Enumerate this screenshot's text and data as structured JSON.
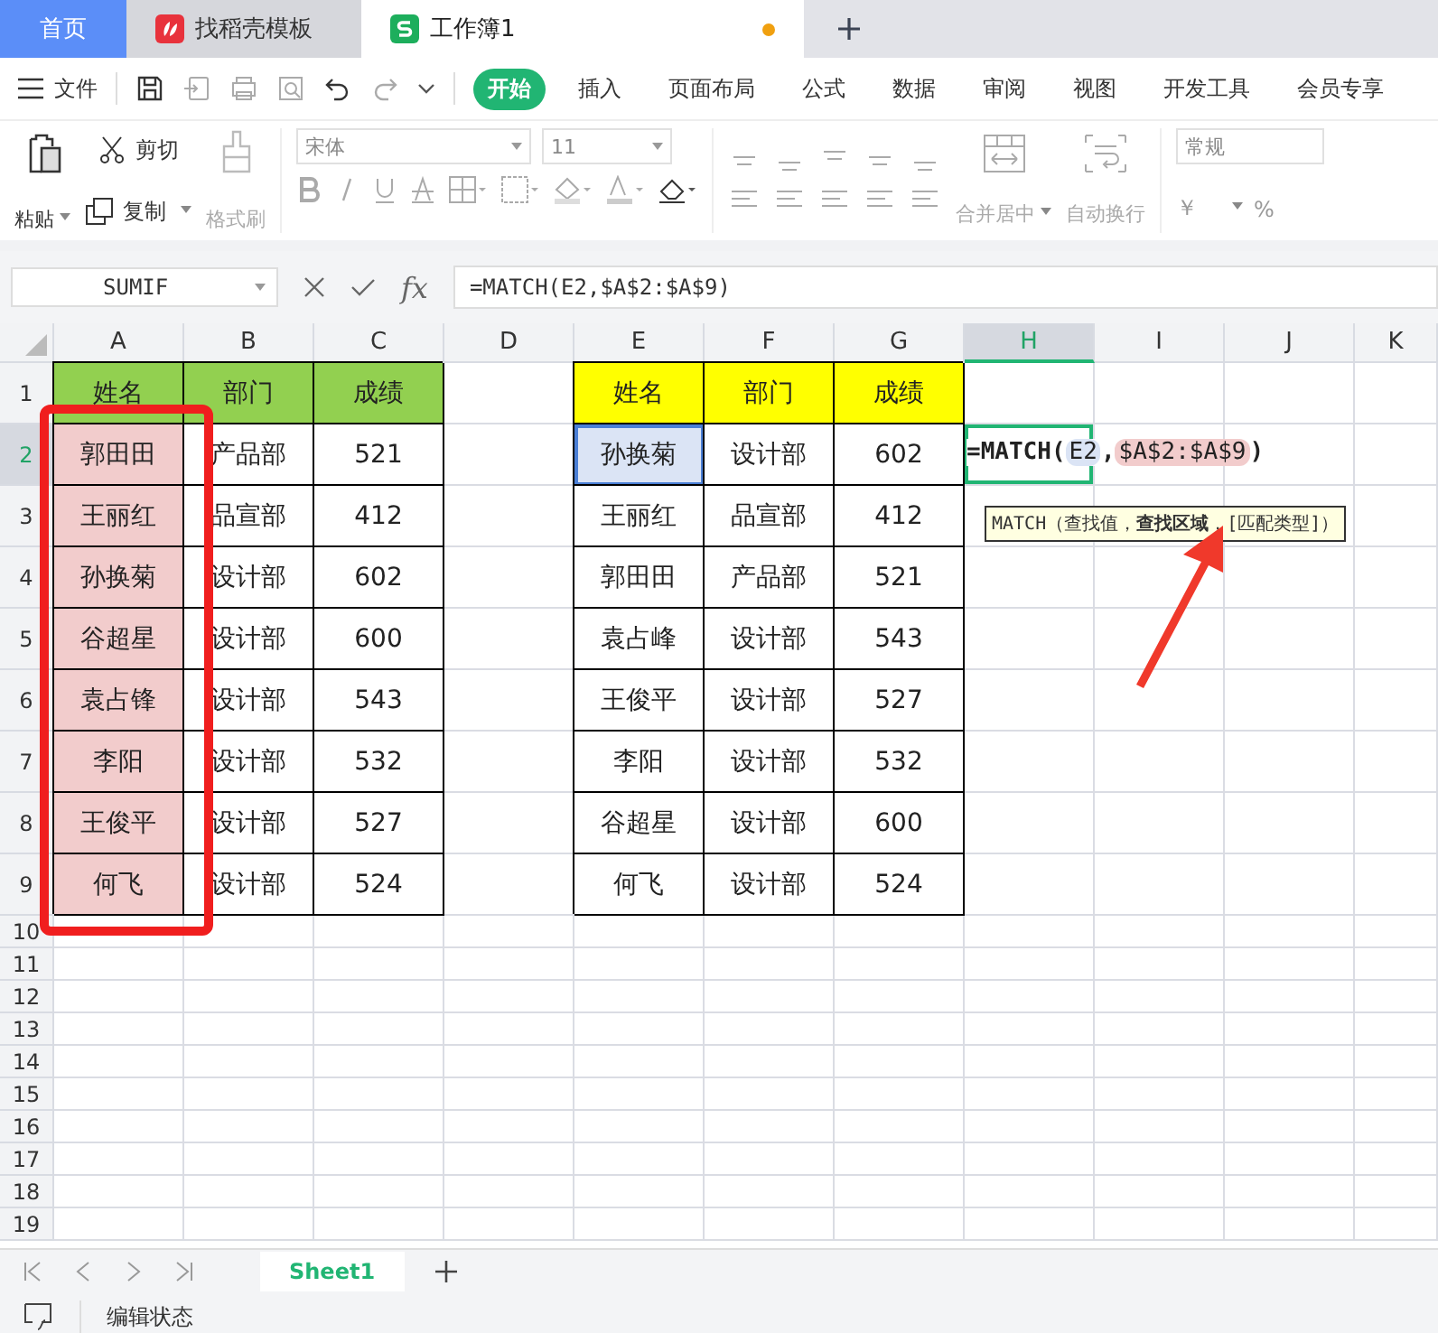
{
  "doc_tabs": [
    {
      "label": "首页",
      "kind": "home",
      "selected": false
    },
    {
      "label": "找稻壳模板",
      "kind": "template",
      "selected": false
    },
    {
      "label": "工作簿1",
      "kind": "sheet",
      "selected": true,
      "unsaved": true
    }
  ],
  "menu": {
    "file": "文件",
    "tabs": [
      {
        "label": "开始",
        "selected": true
      },
      {
        "label": "插入",
        "selected": false
      },
      {
        "label": "页面布局",
        "selected": false
      },
      {
        "label": "公式",
        "selected": false
      },
      {
        "label": "数据",
        "selected": false
      },
      {
        "label": "审阅",
        "selected": false
      },
      {
        "label": "视图",
        "selected": false
      },
      {
        "label": "开发工具",
        "selected": false
      },
      {
        "label": "会员专享",
        "selected": false
      }
    ]
  },
  "ribbon": {
    "paste": "粘贴",
    "cut": "剪切",
    "copy": "复制",
    "format_painter": "格式刷",
    "font": "宋体",
    "font_size": "11",
    "merge": "合并居中",
    "wrap": "自动换行",
    "number_format": "常规",
    "currency": "￥",
    "percent": "%"
  },
  "formula_bar": {
    "name_box": "SUMIF",
    "fx": "fx",
    "formula": "=MATCH(E2,$A$2:$A$9)"
  },
  "columns": [
    {
      "label": "A",
      "selected": false
    },
    {
      "label": "B",
      "selected": false
    },
    {
      "label": "C",
      "selected": false
    },
    {
      "label": "D",
      "selected": false
    },
    {
      "label": "E",
      "selected": false
    },
    {
      "label": "F",
      "selected": false
    },
    {
      "label": "G",
      "selected": false
    },
    {
      "label": "H",
      "selected": true
    },
    {
      "label": "I",
      "selected": false
    },
    {
      "label": "J",
      "selected": false
    },
    {
      "label": "K",
      "selected": false
    }
  ],
  "rows": [
    {
      "label": "1",
      "selected": false,
      "cells": [
        {
          "text": "姓名",
          "color": "#92d050"
        },
        {
          "text": "部门",
          "color": "#92d050"
        },
        {
          "text": "成绩",
          "color": "#92d050"
        },
        null,
        {
          "text": "姓名",
          "color": "#ffff00"
        },
        {
          "text": "部门",
          "color": "#ffff00"
        },
        {
          "text": "成绩",
          "color": "#ffff00"
        },
        null,
        null,
        null,
        null
      ]
    },
    {
      "label": "2",
      "selected": true,
      "cells": [
        {
          "text": "郭田田",
          "color": "#f2cccc"
        },
        {
          "text": "产品部"
        },
        {
          "text": "521"
        },
        null,
        {
          "text": "孙换菊",
          "color": "#dbe4f5",
          "ref": true
        },
        {
          "text": "设计部"
        },
        {
          "text": "602"
        },
        {
          "kind": "editing"
        },
        null,
        null,
        null
      ]
    },
    {
      "label": "3",
      "selected": false,
      "cells": [
        {
          "text": "王丽红",
          "color": "#f2cccc"
        },
        {
          "text": "品宣部"
        },
        {
          "text": "412"
        },
        null,
        {
          "text": "王丽红"
        },
        {
          "text": "品宣部"
        },
        {
          "text": "412"
        },
        null,
        null,
        null,
        null
      ]
    },
    {
      "label": "4",
      "selected": false,
      "cells": [
        {
          "text": "孙换菊",
          "color": "#f2cccc"
        },
        {
          "text": "设计部"
        },
        {
          "text": "602"
        },
        null,
        {
          "text": "郭田田"
        },
        {
          "text": "产品部"
        },
        {
          "text": "521"
        },
        null,
        null,
        null,
        null
      ]
    },
    {
      "label": "5",
      "selected": false,
      "cells": [
        {
          "text": "谷超星",
          "color": "#f2cccc"
        },
        {
          "text": "设计部"
        },
        {
          "text": "600"
        },
        null,
        {
          "text": "袁占峰"
        },
        {
          "text": "设计部"
        },
        {
          "text": "543"
        },
        null,
        null,
        null,
        null
      ]
    },
    {
      "label": "6",
      "selected": false,
      "cells": [
        {
          "text": "袁占锋",
          "color": "#f2cccc"
        },
        {
          "text": "设计部"
        },
        {
          "text": "543"
        },
        null,
        {
          "text": "王俊平"
        },
        {
          "text": "设计部"
        },
        {
          "text": "527"
        },
        null,
        null,
        null,
        null
      ]
    },
    {
      "label": "7",
      "selected": false,
      "cells": [
        {
          "text": "李阳",
          "color": "#f2cccc"
        },
        {
          "text": "设计部"
        },
        {
          "text": "532"
        },
        null,
        {
          "text": "李阳"
        },
        {
          "text": "设计部"
        },
        {
          "text": "532"
        },
        null,
        null,
        null,
        null
      ]
    },
    {
      "label": "8",
      "selected": false,
      "cells": [
        {
          "text": "王俊平",
          "color": "#f2cccc"
        },
        {
          "text": "设计部"
        },
        {
          "text": "527"
        },
        null,
        {
          "text": "谷超星"
        },
        {
          "text": "设计部"
        },
        {
          "text": "600"
        },
        null,
        null,
        null,
        null
      ]
    },
    {
      "label": "9",
      "selected": false,
      "cells": [
        {
          "text": "何飞",
          "color": "#f2cccc"
        },
        {
          "text": "设计部"
        },
        {
          "text": "524"
        },
        null,
        {
          "text": "何飞"
        },
        {
          "text": "设计部"
        },
        {
          "text": "524"
        },
        null,
        null,
        null,
        null
      ]
    },
    {
      "label": "10",
      "selected": false
    },
    {
      "label": "11",
      "selected": false
    },
    {
      "label": "12",
      "selected": false
    },
    {
      "label": "13",
      "selected": false
    },
    {
      "label": "14",
      "selected": false
    },
    {
      "label": "15",
      "selected": false
    },
    {
      "label": "16",
      "selected": false
    },
    {
      "label": "17",
      "selected": false
    },
    {
      "label": "18",
      "selected": false
    },
    {
      "label": "19",
      "selected": false
    }
  ],
  "editing_formula": [
    {
      "text": "=MATCH(",
      "kind": "plain"
    },
    {
      "text": "E2",
      "kind": "ref_blue"
    },
    {
      "text": ",",
      "kind": "plain"
    },
    {
      "text": "$A$2:$A$9",
      "kind": "ref_red"
    },
    {
      "text": ")",
      "kind": "plain"
    }
  ],
  "tooltip": "MATCH（查找值，**查找区域**，[匹配类型]）",
  "sheet_tabs": [
    {
      "label": "Sheet1",
      "selected": true
    }
  ],
  "status": "编辑状态"
}
